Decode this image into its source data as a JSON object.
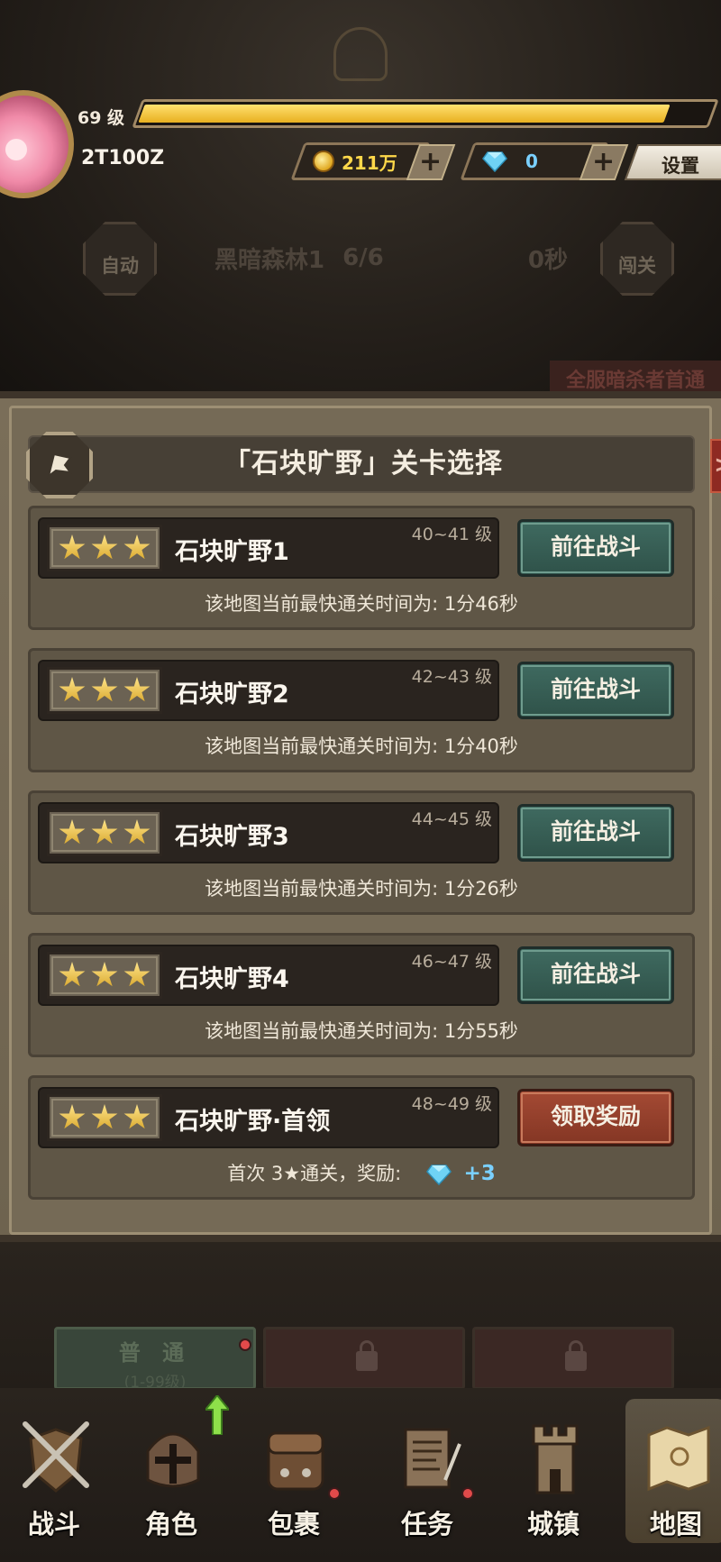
{
  "header": {
    "level": "69 级",
    "exp_fraction": 0.92,
    "player_name": "2T100Z",
    "gold": "211万",
    "gems": "0",
    "plus": "+",
    "settings_label": "设置"
  },
  "auto_battle": {
    "auto_label": "自动",
    "map_name": "黑暗森林1",
    "progress": "6/6",
    "time": "0秒",
    "challenge_label": "闯关"
  },
  "banner_text": "全服暗杀者首通",
  "panel": {
    "title": "「石块旷野」关卡选择",
    "close_symbol": ">",
    "stages": [
      {
        "name": "石块旷野1",
        "level": "40~41 级",
        "button": "前往战斗",
        "info": "该地图当前最快通关时间为:  1分46秒",
        "stars": 3
      },
      {
        "name": "石块旷野2",
        "level": "42~43 级",
        "button": "前往战斗",
        "info": "该地图当前最快通关时间为:  1分40秒",
        "stars": 3
      },
      {
        "name": "石块旷野3",
        "level": "44~45 级",
        "button": "前往战斗",
        "info": "该地图当前最快通关时间为:  1分26秒",
        "stars": 3
      },
      {
        "name": "石块旷野4",
        "level": "46~47 级",
        "button": "前往战斗",
        "info": "该地图当前最快通关时间为:  1分55秒",
        "stars": 3
      },
      {
        "name": "石块旷野·首领",
        "level": "48~49 级",
        "button": "领取奖励",
        "info": "首次 3★通关，奖励:",
        "reward": "+3",
        "stars": 3
      }
    ]
  },
  "difficulty": {
    "normal_label": "普 通",
    "normal_range": "(1-99级)"
  },
  "nav": {
    "items": [
      {
        "label": "战斗"
      },
      {
        "label": "角色"
      },
      {
        "label": "包裹"
      },
      {
        "label": "任务"
      },
      {
        "label": "城镇"
      },
      {
        "label": "地图"
      }
    ]
  },
  "colors": {
    "go_button": "#3f6a60",
    "reward_button": "#a44a34",
    "gold_text": "#ffd84a",
    "gem_text": "#7ad0ff"
  }
}
